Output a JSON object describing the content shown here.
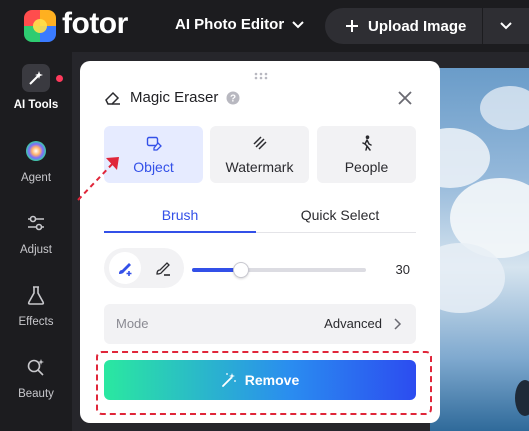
{
  "topbar": {
    "logo_text": "fotor",
    "app_menu_label": "AI Photo Editor",
    "upload_label": "Upload Image"
  },
  "sidebar": {
    "items": [
      {
        "label": "AI Tools",
        "icon": "sparkle-wand-icon",
        "active": true
      },
      {
        "label": "Agent",
        "icon": "agent-orb-icon"
      },
      {
        "label": "Adjust",
        "icon": "sliders-icon"
      },
      {
        "label": "Effects",
        "icon": "flask-icon"
      },
      {
        "label": "Beauty",
        "icon": "beauty-sparkle-icon"
      }
    ]
  },
  "panel": {
    "title": "Magic Eraser",
    "modes": [
      {
        "label": "Object",
        "icon": "object-eraser-icon",
        "active": true
      },
      {
        "label": "Watermark",
        "icon": "watermark-icon"
      },
      {
        "label": "People",
        "icon": "walking-person-icon"
      }
    ],
    "tabs": [
      {
        "label": "Brush",
        "active": true
      },
      {
        "label": "Quick Select"
      }
    ],
    "brush_size": "30",
    "brush_size_fraction": 0.28,
    "mode_label": "Mode",
    "mode_value": "Advanced",
    "remove_label": "Remove"
  },
  "colors": {
    "accent": "#3350e8",
    "active_card_bg": "#e6ebff",
    "highlight_red": "#e0263a",
    "gradient_start": "#2ae8a0",
    "gradient_end": "#2c4cf0"
  }
}
